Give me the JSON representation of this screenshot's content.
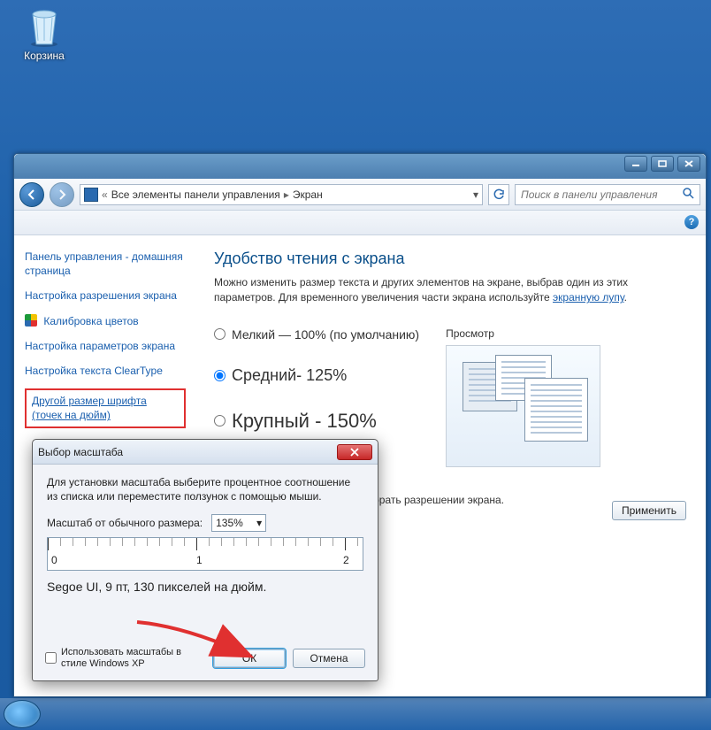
{
  "desktop": {
    "recycle_bin_label": "Корзина"
  },
  "window": {
    "breadcrumb_root": "Все элементы панели управления",
    "breadcrumb_leaf": "Экран",
    "search_placeholder": "Поиск в панели управления"
  },
  "sidebar": {
    "home": "Панель управления - домашняя страница",
    "items": [
      {
        "label": "Настройка разрешения экрана"
      },
      {
        "label": "Калибровка цветов",
        "shield": true
      },
      {
        "label": "Настройка параметров экрана"
      },
      {
        "label": "Настройка текста ClearType"
      },
      {
        "label": "Другой размер шрифта (точек на дюйм)",
        "active": true,
        "highlighted": true
      }
    ]
  },
  "main": {
    "heading": "Удобство чтения с экрана",
    "intro_prefix": "Можно изменить размер текста и других элементов на экране, выбрав один из этих параметров. Для временного увеличения части экрана используйте ",
    "intro_link": "экранную лупу",
    "intro_suffix": ".",
    "options": [
      {
        "label": "Мелкий — 100% (по умолчанию)",
        "checked": false
      },
      {
        "label": "Средний- 125%",
        "checked": true
      },
      {
        "label": "Крупный - 150%",
        "checked": false
      }
    ],
    "preview_label": "Просмотр",
    "note": "поместиться на экране, если выбрать разрешении экрана.",
    "apply": "Применить"
  },
  "dialog": {
    "title": "Выбор масштаба",
    "desc": "Для установки масштаба выберите процентное соотношение из списка или переместите ползунок с помощью мыши.",
    "scale_label": "Масштаб от обычного размера:",
    "scale_value": "135%",
    "ruler_labels": [
      "0",
      "1",
      "2"
    ],
    "sample": "Segoe UI, 9 пт, 130 пикселей на дюйм.",
    "xp_check": "Использовать масштабы в стиле Windows XP",
    "ok": "ОК",
    "cancel": "Отмена"
  }
}
